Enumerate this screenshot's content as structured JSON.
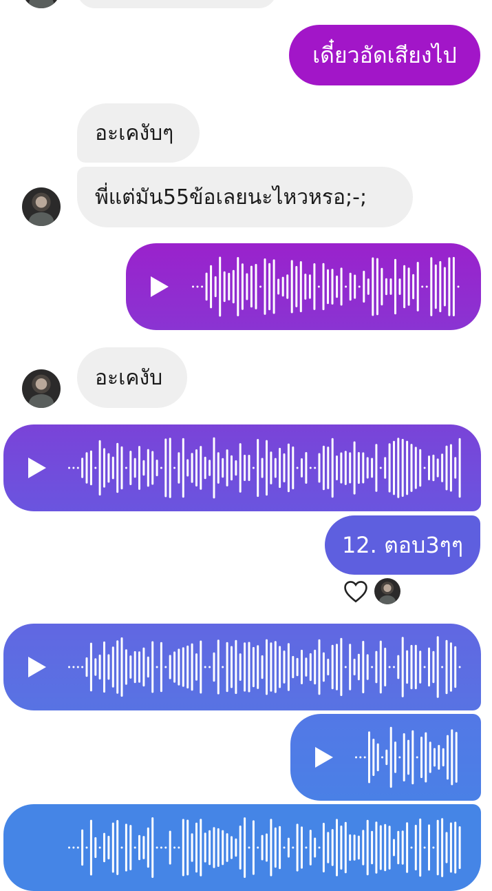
{
  "messages": {
    "out_1": "เดี๋ยวอัดเสียงไป",
    "in_1": "อะเคงับๆ",
    "in_2": "พี่แต่มัน55ข้อเลยนะไหวหรอ;-;",
    "in_3": "อะเคงับ",
    "out_2": "12. ตอบ3ๆๆ"
  },
  "icons": {
    "play": "play-icon",
    "reaction": "heart-icon",
    "avatar": "avatar"
  },
  "colors": {
    "incoming_bubble": "#efefef",
    "gradient_top": "#a216c8",
    "gradient_bottom": "#4585e6",
    "waveform": "#ffffff"
  }
}
